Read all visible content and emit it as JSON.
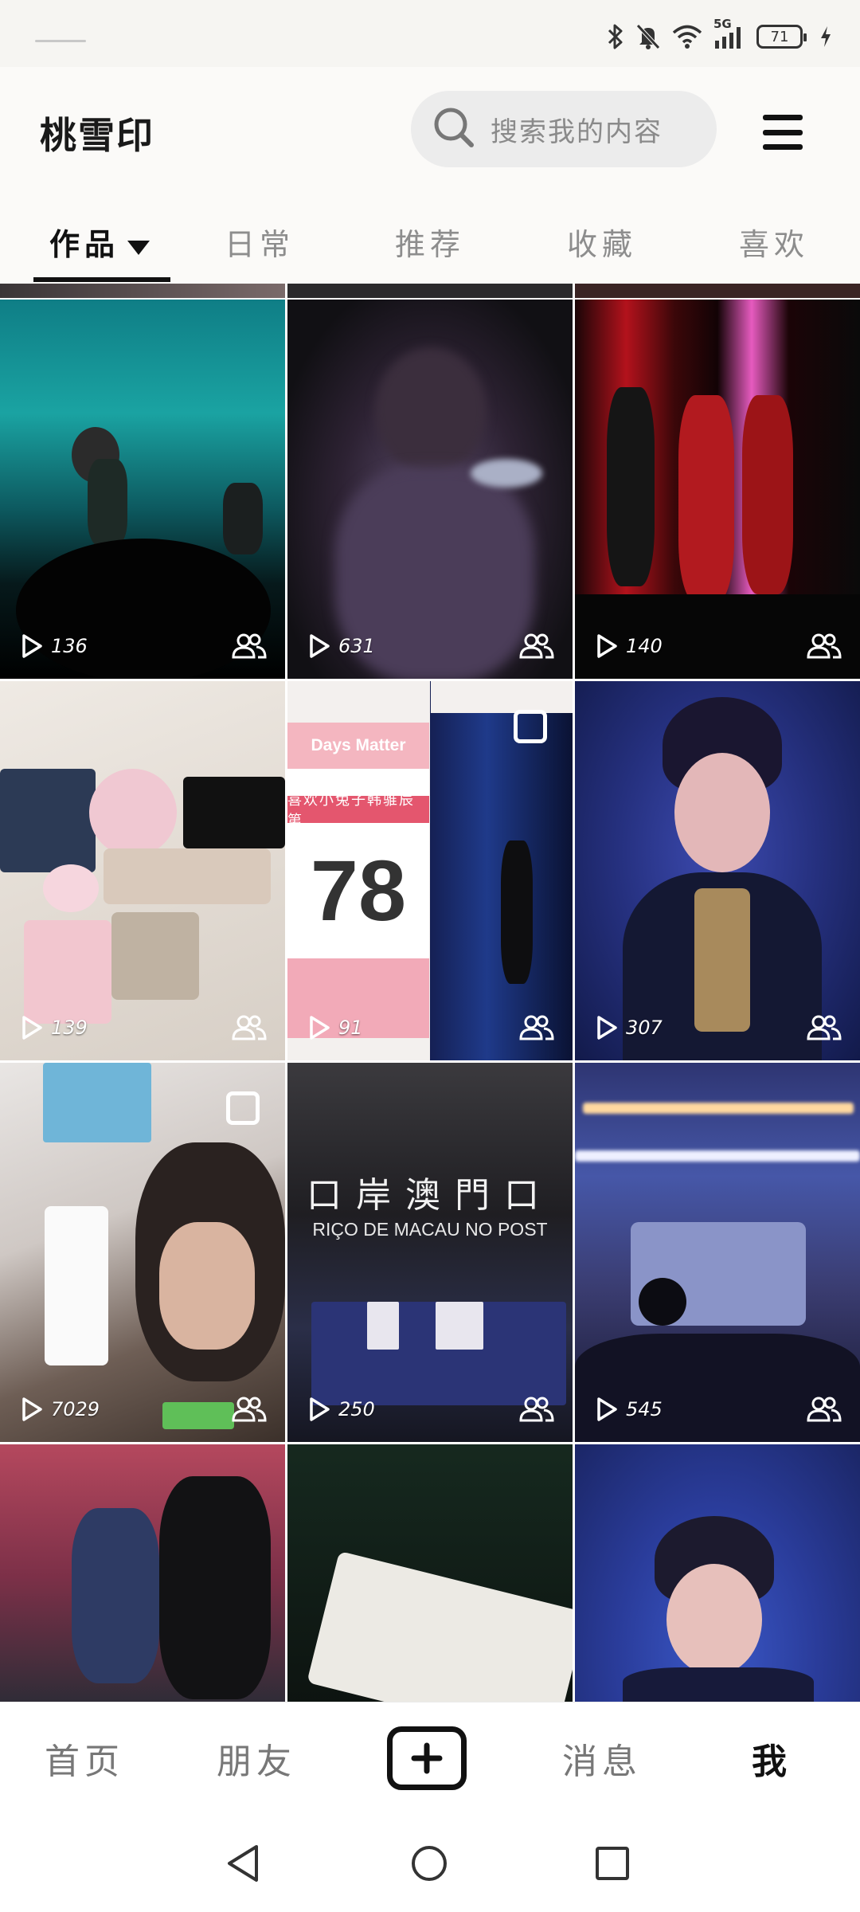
{
  "status_bar": {
    "network": "5G",
    "battery": "71",
    "icons": [
      "bluetooth-icon",
      "mute-icon",
      "wifi-icon",
      "signal-icon",
      "battery-icon",
      "charging-icon"
    ]
  },
  "header": {
    "title": "桃雪印",
    "search_placeholder": "搜索我的内容",
    "menu_icon": "hamburger-menu-icon"
  },
  "tabs": [
    {
      "label": "作品",
      "active": true
    },
    {
      "label": "日常",
      "active": false
    },
    {
      "label": "推荐",
      "active": false
    },
    {
      "label": "收藏",
      "active": false
    },
    {
      "label": "喜欢",
      "active": false
    }
  ],
  "grid": {
    "items": [
      {
        "plays": "136"
      },
      {
        "plays": "631"
      },
      {
        "plays": "140"
      },
      {
        "plays": "139"
      },
      {
        "plays": "91",
        "card_title": "Days Matter",
        "card_band": "喜欢小兔子韩骓辰第",
        "card_number": "78"
      },
      {
        "plays": "307"
      },
      {
        "plays": "7029"
      },
      {
        "plays": "250",
        "sign_text": "口岸澳門口",
        "sign_sub": "RIÇO DE MACAU NO POST"
      },
      {
        "plays": "545"
      },
      {
        "plays": ""
      },
      {
        "plays": ""
      },
      {
        "plays": ""
      }
    ]
  },
  "bottom_nav": {
    "home": "首页",
    "friends": "朋友",
    "add_icon": "plus-icon",
    "messages": "消息",
    "me": "我"
  },
  "colors": {
    "accent_red": "#e4566e",
    "text_dark": "#111111",
    "text_muted": "#8d8d8d"
  }
}
